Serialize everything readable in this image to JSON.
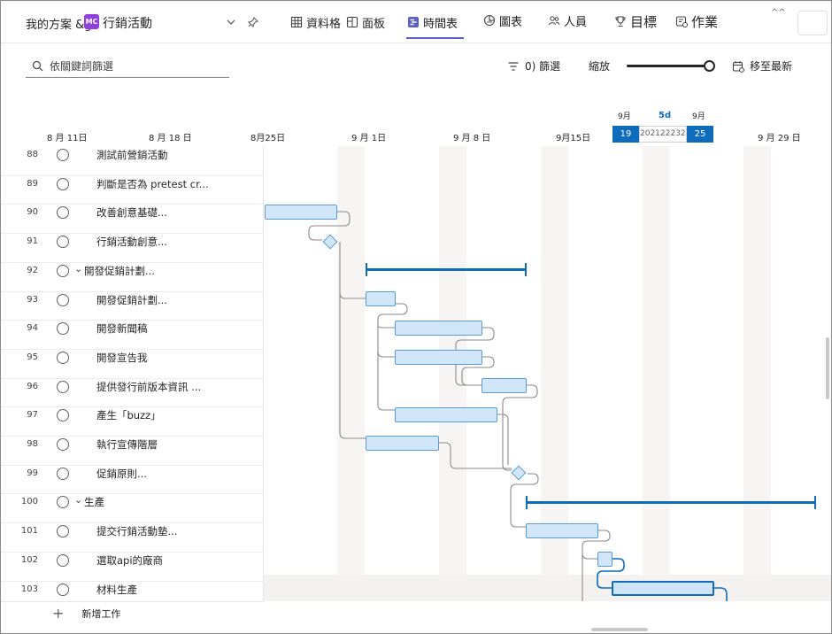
{
  "header": {
    "plan_prefix": "我的方案 &g",
    "badge": "MC",
    "plan_name": "行銷活動",
    "tabs": [
      {
        "label": "資料格",
        "icon": "grid-icon"
      },
      {
        "label": "面板",
        "icon": "board-icon"
      },
      {
        "label": "時間表",
        "icon": "timeline-icon"
      },
      {
        "label": "圖表",
        "icon": "chart-icon"
      },
      {
        "label": "人員",
        "icon": "people-icon"
      },
      {
        "label": "目標",
        "icon": "trophy-icon"
      },
      {
        "label": "作業",
        "icon": "task-icon"
      }
    ],
    "active_tab": "時間表",
    "more": "^^"
  },
  "toolbar": {
    "search_placeholder": "依關鍵詞篩選",
    "filter_label": "0) 篩選",
    "zoom_label": "縮放",
    "zoom_level": 1.0,
    "jump_label": "移至最新"
  },
  "timeline": {
    "dates": [
      "8 月 11日",
      "8 月 18 日",
      "8月25日",
      "9 月 1日",
      "9 月 8 日",
      "9月15日",
      "9 月 29 日"
    ],
    "selection": {
      "start_month": "9月",
      "end_month": "9月",
      "duration": "5d",
      "start_day": "19",
      "middle": "2021222324",
      "end_day": "25"
    }
  },
  "tasks": [
    {
      "num": "88",
      "name": "測試前營銷活動",
      "group": false
    },
    {
      "num": "89",
      "name": "判斷是否為 pretest cr...",
      "group": false
    },
    {
      "num": "90",
      "name": "改善創意基礎...",
      "group": false
    },
    {
      "num": "91",
      "name": "行銷活動創意...",
      "group": false
    },
    {
      "num": "92",
      "name": "開發促銷計劃...",
      "group": true
    },
    {
      "num": "93",
      "name": "開發促銷計劃...",
      "group": false
    },
    {
      "num": "94",
      "name": "開發新聞稿",
      "group": false
    },
    {
      "num": "95",
      "name": "開發宣告我",
      "group": false
    },
    {
      "num": "96",
      "name": "提供發行前版本資訊 ...",
      "group": false
    },
    {
      "num": "97",
      "name": "產生「buzz」",
      "group": false
    },
    {
      "num": "98",
      "name": "執行宣傳階層",
      "group": false
    },
    {
      "num": "99",
      "name": "促銷原則...",
      "group": false
    },
    {
      "num": "100",
      "name": "生產",
      "group": true
    },
    {
      "num": "101",
      "name": "提交行銷活動墊...",
      "group": false
    },
    {
      "num": "102",
      "name": "選取api的廠商",
      "group": false
    },
    {
      "num": "103",
      "name": "材料生產",
      "group": false
    }
  ],
  "add_task_label": "新增工作"
}
